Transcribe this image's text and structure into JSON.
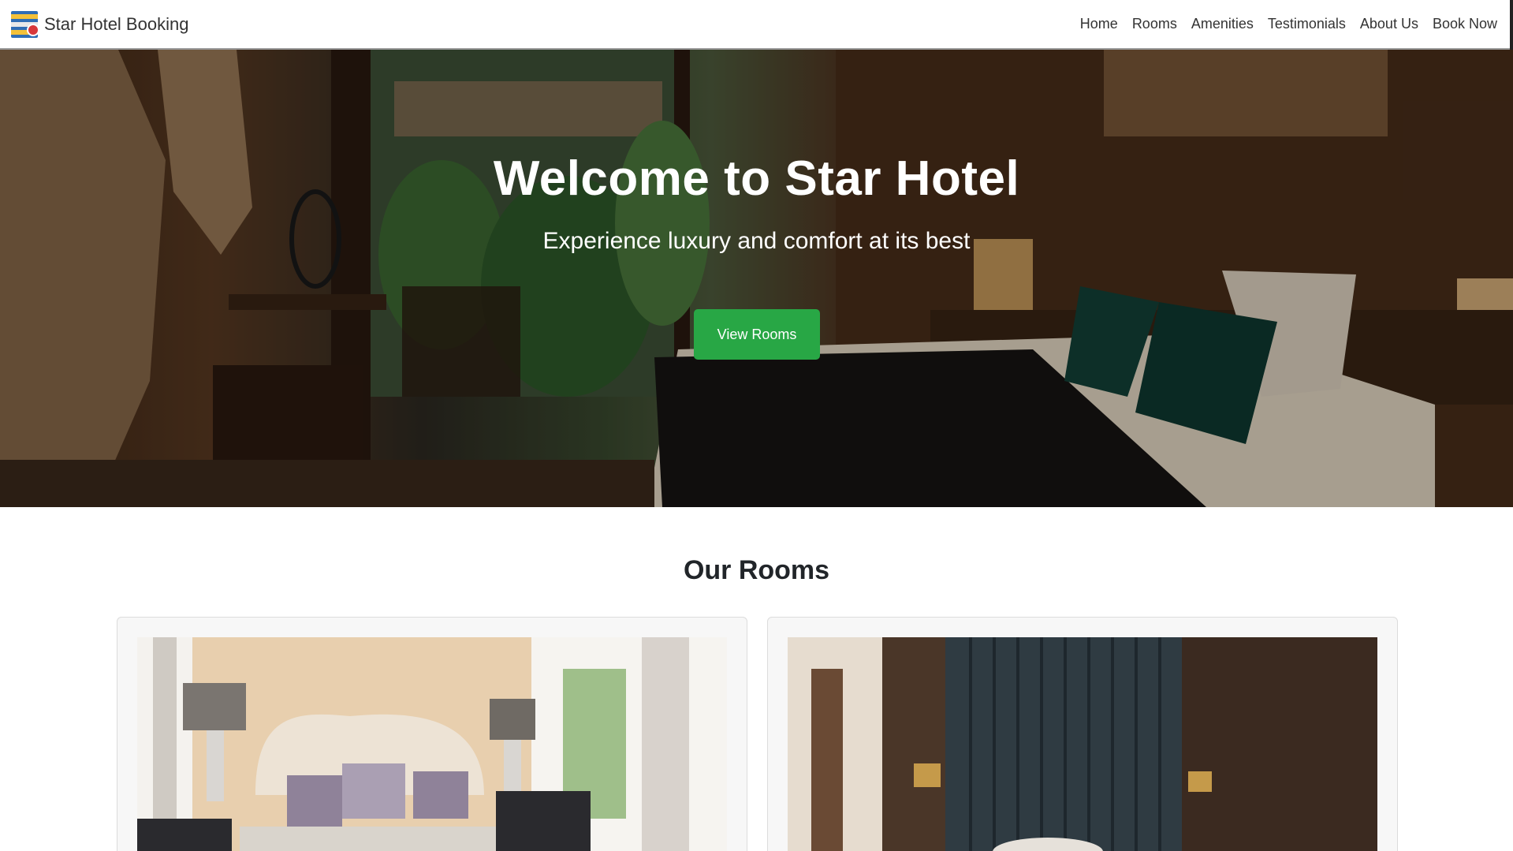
{
  "navbar": {
    "brand": "Star Hotel Booking",
    "logo_icon": "hotel-building-icon",
    "links": [
      "Home",
      "Rooms",
      "Amenities",
      "Testimonials",
      "About Us",
      "Book Now"
    ]
  },
  "hero": {
    "title": "Welcome to Star Hotel",
    "subtitle": "Experience luxury and comfort at its best",
    "button": "View Rooms"
  },
  "rooms": {
    "title": "Our Rooms"
  },
  "colors": {
    "accent_green": "#28a745",
    "nav_text": "#333333"
  }
}
